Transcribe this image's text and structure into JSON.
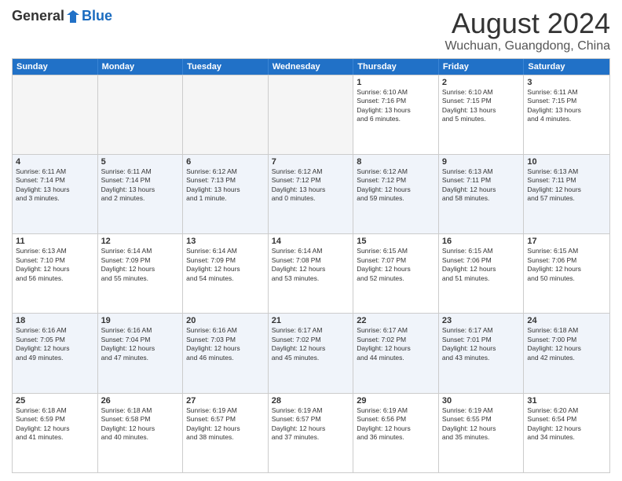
{
  "header": {
    "logo": {
      "general": "General",
      "blue": "Blue",
      "tagline": ""
    },
    "title": "August 2024",
    "location": "Wuchuan, Guangdong, China"
  },
  "calendar": {
    "days_of_week": [
      "Sunday",
      "Monday",
      "Tuesday",
      "Wednesday",
      "Thursday",
      "Friday",
      "Saturday"
    ],
    "rows": [
      [
        {
          "day": "",
          "info": "",
          "empty": true
        },
        {
          "day": "",
          "info": "",
          "empty": true
        },
        {
          "day": "",
          "info": "",
          "empty": true
        },
        {
          "day": "",
          "info": "",
          "empty": true
        },
        {
          "day": "1",
          "info": "Sunrise: 6:10 AM\nSunset: 7:16 PM\nDaylight: 13 hours\nand 6 minutes."
        },
        {
          "day": "2",
          "info": "Sunrise: 6:10 AM\nSunset: 7:15 PM\nDaylight: 13 hours\nand 5 minutes."
        },
        {
          "day": "3",
          "info": "Sunrise: 6:11 AM\nSunset: 7:15 PM\nDaylight: 13 hours\nand 4 minutes."
        }
      ],
      [
        {
          "day": "4",
          "info": "Sunrise: 6:11 AM\nSunset: 7:14 PM\nDaylight: 13 hours\nand 3 minutes."
        },
        {
          "day": "5",
          "info": "Sunrise: 6:11 AM\nSunset: 7:14 PM\nDaylight: 13 hours\nand 2 minutes."
        },
        {
          "day": "6",
          "info": "Sunrise: 6:12 AM\nSunset: 7:13 PM\nDaylight: 13 hours\nand 1 minute."
        },
        {
          "day": "7",
          "info": "Sunrise: 6:12 AM\nSunset: 7:12 PM\nDaylight: 13 hours\nand 0 minutes."
        },
        {
          "day": "8",
          "info": "Sunrise: 6:12 AM\nSunset: 7:12 PM\nDaylight: 12 hours\nand 59 minutes."
        },
        {
          "day": "9",
          "info": "Sunrise: 6:13 AM\nSunset: 7:11 PM\nDaylight: 12 hours\nand 58 minutes."
        },
        {
          "day": "10",
          "info": "Sunrise: 6:13 AM\nSunset: 7:11 PM\nDaylight: 12 hours\nand 57 minutes."
        }
      ],
      [
        {
          "day": "11",
          "info": "Sunrise: 6:13 AM\nSunset: 7:10 PM\nDaylight: 12 hours\nand 56 minutes."
        },
        {
          "day": "12",
          "info": "Sunrise: 6:14 AM\nSunset: 7:09 PM\nDaylight: 12 hours\nand 55 minutes."
        },
        {
          "day": "13",
          "info": "Sunrise: 6:14 AM\nSunset: 7:09 PM\nDaylight: 12 hours\nand 54 minutes."
        },
        {
          "day": "14",
          "info": "Sunrise: 6:14 AM\nSunset: 7:08 PM\nDaylight: 12 hours\nand 53 minutes."
        },
        {
          "day": "15",
          "info": "Sunrise: 6:15 AM\nSunset: 7:07 PM\nDaylight: 12 hours\nand 52 minutes."
        },
        {
          "day": "16",
          "info": "Sunrise: 6:15 AM\nSunset: 7:06 PM\nDaylight: 12 hours\nand 51 minutes."
        },
        {
          "day": "17",
          "info": "Sunrise: 6:15 AM\nSunset: 7:06 PM\nDaylight: 12 hours\nand 50 minutes."
        }
      ],
      [
        {
          "day": "18",
          "info": "Sunrise: 6:16 AM\nSunset: 7:05 PM\nDaylight: 12 hours\nand 49 minutes."
        },
        {
          "day": "19",
          "info": "Sunrise: 6:16 AM\nSunset: 7:04 PM\nDaylight: 12 hours\nand 47 minutes."
        },
        {
          "day": "20",
          "info": "Sunrise: 6:16 AM\nSunset: 7:03 PM\nDaylight: 12 hours\nand 46 minutes."
        },
        {
          "day": "21",
          "info": "Sunrise: 6:17 AM\nSunset: 7:02 PM\nDaylight: 12 hours\nand 45 minutes."
        },
        {
          "day": "22",
          "info": "Sunrise: 6:17 AM\nSunset: 7:02 PM\nDaylight: 12 hours\nand 44 minutes."
        },
        {
          "day": "23",
          "info": "Sunrise: 6:17 AM\nSunset: 7:01 PM\nDaylight: 12 hours\nand 43 minutes."
        },
        {
          "day": "24",
          "info": "Sunrise: 6:18 AM\nSunset: 7:00 PM\nDaylight: 12 hours\nand 42 minutes."
        }
      ],
      [
        {
          "day": "25",
          "info": "Sunrise: 6:18 AM\nSunset: 6:59 PM\nDaylight: 12 hours\nand 41 minutes."
        },
        {
          "day": "26",
          "info": "Sunrise: 6:18 AM\nSunset: 6:58 PM\nDaylight: 12 hours\nand 40 minutes."
        },
        {
          "day": "27",
          "info": "Sunrise: 6:19 AM\nSunset: 6:57 PM\nDaylight: 12 hours\nand 38 minutes."
        },
        {
          "day": "28",
          "info": "Sunrise: 6:19 AM\nSunset: 6:57 PM\nDaylight: 12 hours\nand 37 minutes."
        },
        {
          "day": "29",
          "info": "Sunrise: 6:19 AM\nSunset: 6:56 PM\nDaylight: 12 hours\nand 36 minutes."
        },
        {
          "day": "30",
          "info": "Sunrise: 6:19 AM\nSunset: 6:55 PM\nDaylight: 12 hours\nand 35 minutes."
        },
        {
          "day": "31",
          "info": "Sunrise: 6:20 AM\nSunset: 6:54 PM\nDaylight: 12 hours\nand 34 minutes."
        }
      ]
    ]
  }
}
